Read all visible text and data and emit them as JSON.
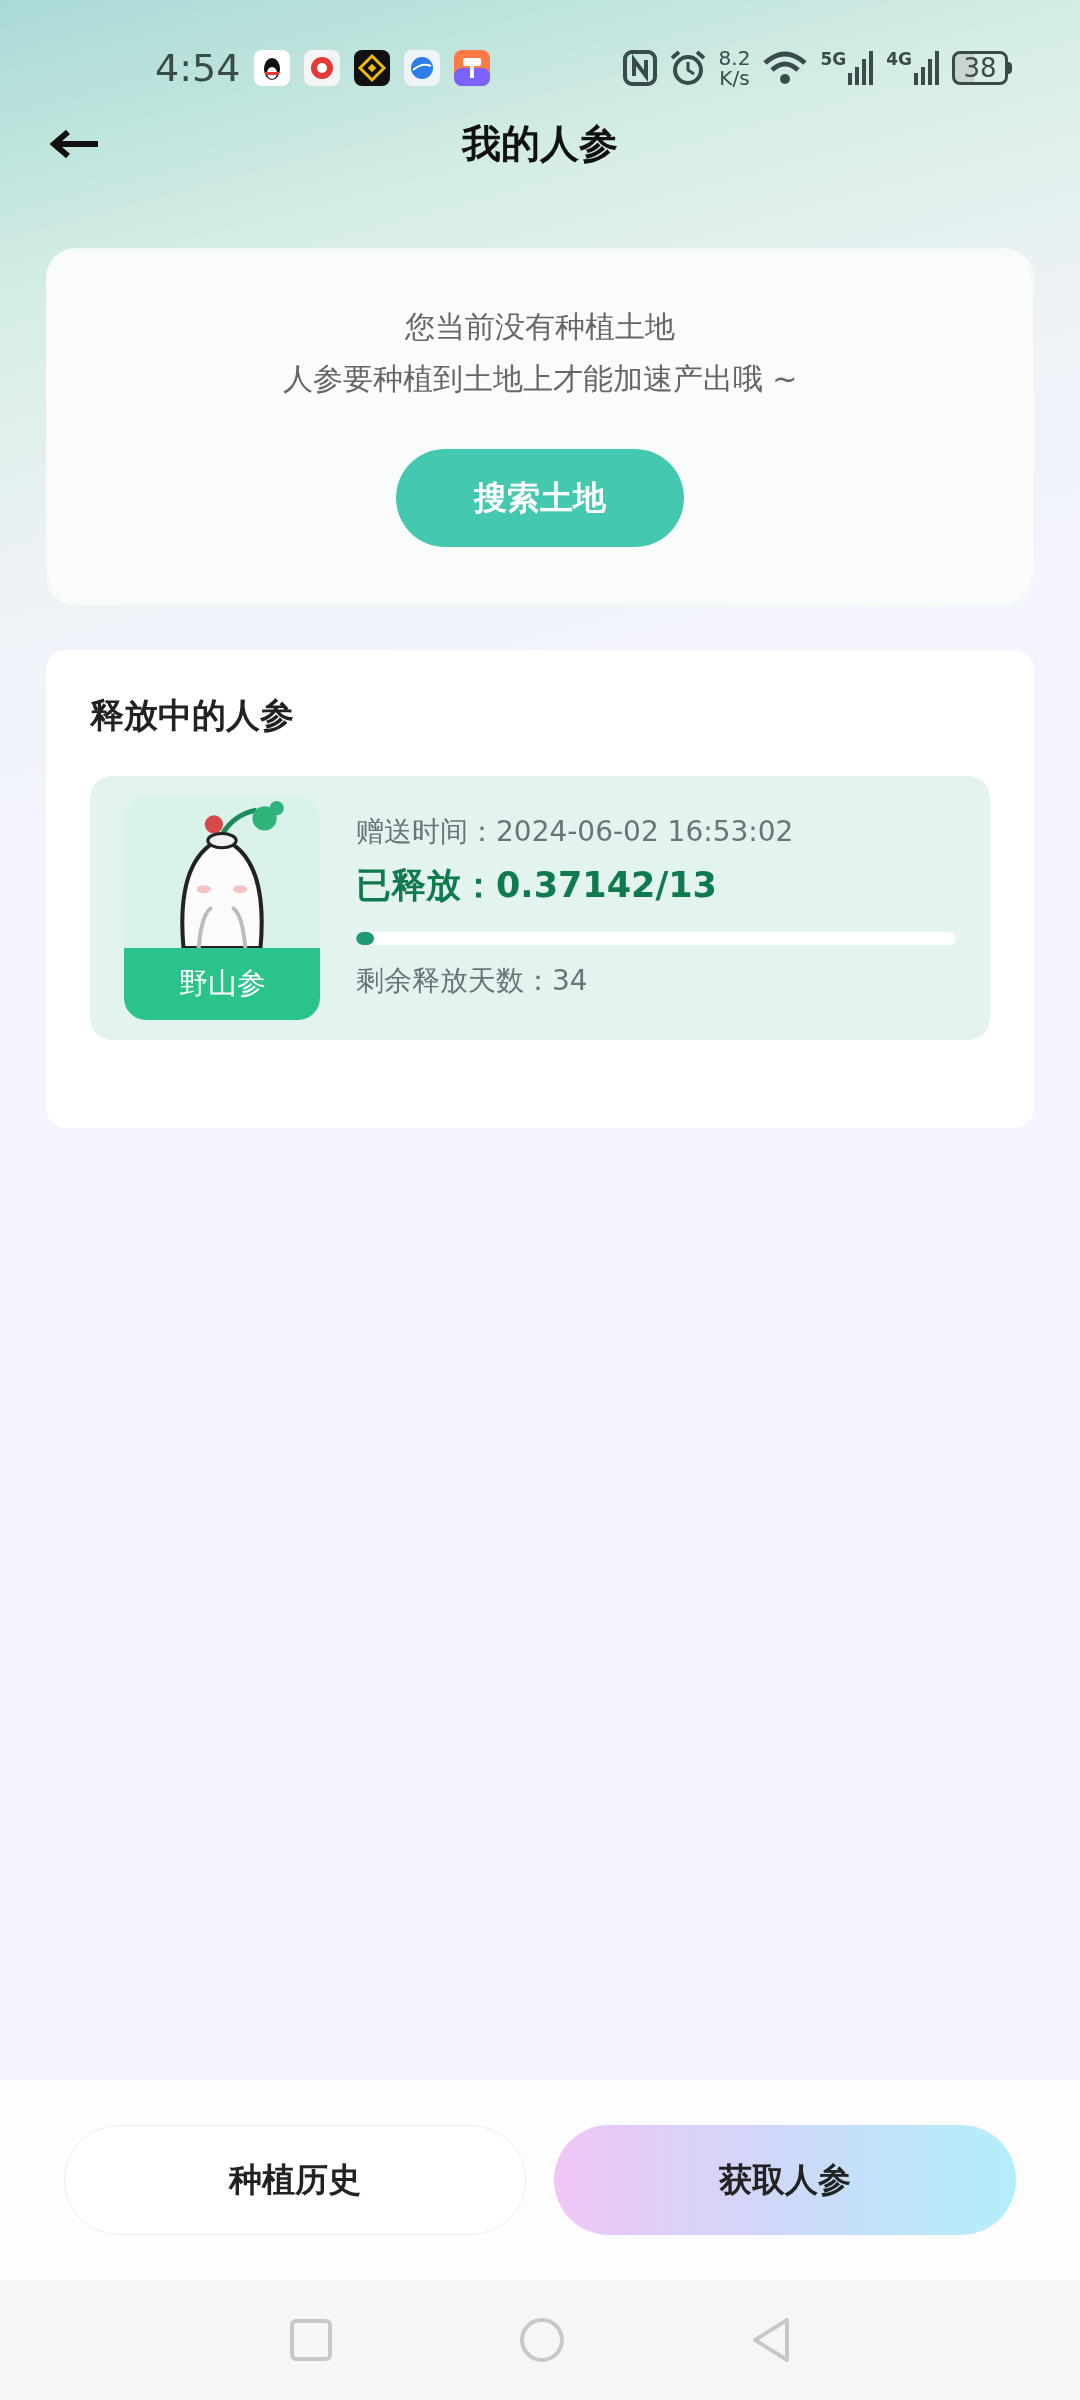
{
  "status_bar": {
    "time": "4:54",
    "speed_value": "8.2",
    "speed_unit": "K/s",
    "network_1": "5G",
    "network_2": "4G",
    "battery": "38"
  },
  "header": {
    "title": "我的人参"
  },
  "land_notice": {
    "line_1": "您当前没有种植土地",
    "line_2": "人参要种植到土地上才能加速产出哦 ~",
    "button": "搜索土地"
  },
  "releasing": {
    "title": "释放中的人参",
    "items": [
      {
        "kind": "picture",
        "badge": "野山参",
        "gift_time_label": "赠送时间：",
        "gift_time": "2024-06-02 16:53:02",
        "released_label": "已释放：",
        "released": "0.37142/13",
        "level": 0.03,
        "days_label": "剩余释放天数：",
        "days": "34"
      }
    ]
  },
  "bottom_bar": {
    "buttons": [
      {
        "label": "种植历史",
        "kind": "outline"
      },
      {
        "label": "获取人参",
        "kind": "gradient"
      }
    ]
  }
}
